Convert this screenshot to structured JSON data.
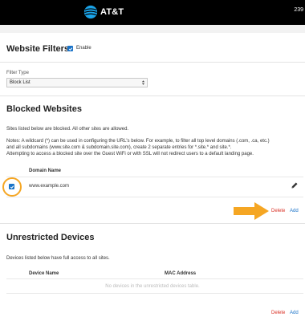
{
  "header": {
    "brand": "AT&T",
    "right_text": "239"
  },
  "website_filters": {
    "title": "Website Filters",
    "enable_label": "Enable",
    "enabled": true,
    "filter_type_label": "Filter Type",
    "filter_type_value": "Block List"
  },
  "blocked_websites": {
    "title": "Blocked Websites",
    "intro": "Sites listed below are blocked. All other sites are allowed.",
    "notes_line1": "Notes: A wildcard (*) can be used in configuring the URL's below. For example, to filter all top level domains (.com, .ca, etc.)",
    "notes_line2": "and all subdomains (www.site.com & subdomain.site.com), create 2 separate entries for *.site.* and site.*.",
    "notes_line3": "Attempting to access a blocked site over the Guest WiFi or with SSL will not redirect users to a default landing page.",
    "column_domain": "Domain Name",
    "rows": [
      {
        "domain": "www.example.com",
        "checked": true
      }
    ],
    "delete_label": "Delete",
    "add_label": "Add"
  },
  "unrestricted_devices": {
    "title": "Unrestricted Devices",
    "intro": "Devices listed below have full access to all sites.",
    "column_device": "Device Name",
    "column_mac": "MAC Address",
    "empty_message": "No devices in the unrestricted devices table.",
    "delete_label": "Delete",
    "add_label": "Add"
  },
  "colors": {
    "accent": "#1a73c8",
    "delete": "#d93025",
    "highlight_orange": "#f5a623",
    "header_bg": "#000000"
  }
}
